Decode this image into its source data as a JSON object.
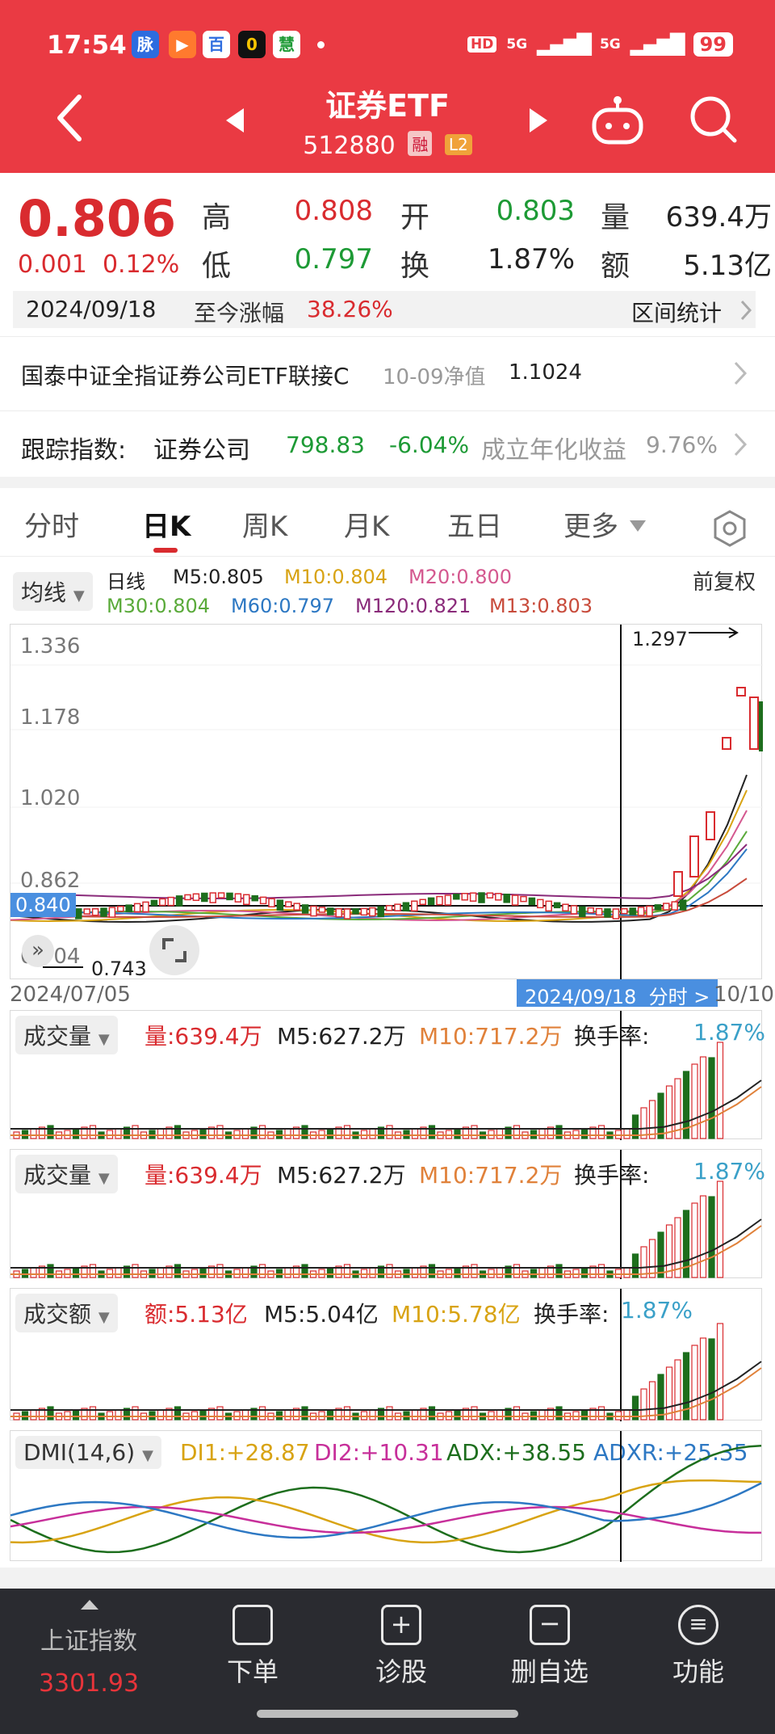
{
  "status": {
    "time": "17:54",
    "app_icons": [
      "脉",
      "▶",
      "百",
      "0",
      "慧"
    ],
    "battery": "99",
    "signal": "5G"
  },
  "header": {
    "title": "证券ETF",
    "code": "512880",
    "tag_margin": "融",
    "tag_level": "L2"
  },
  "quote": {
    "price": "0.806",
    "change": "0.001",
    "change_pct": "0.12%",
    "high_label": "高",
    "high": "0.808",
    "open_label": "开",
    "open": "0.803",
    "vol_label": "量",
    "vol": "639.4万",
    "low_label": "低",
    "low": "0.797",
    "turn_label": "换",
    "turn": "1.87%",
    "amt_label": "额",
    "amt": "5.13亿"
  },
  "range": {
    "date": "2024/09/18",
    "label": "至今涨幅",
    "value": "38.26%",
    "stat": "区间统计"
  },
  "fund": {
    "name": "国泰中证全指证券公司ETF联接C",
    "nav_label": "10-09净值",
    "nav": "1.1024"
  },
  "track": {
    "label": "跟踪指数:",
    "index": "证券公司",
    "value": "798.83",
    "pct": "-6.04%",
    "annual_label": "成立年化收益",
    "annual": "9.76%"
  },
  "tabs": [
    "分时",
    "日K",
    "周K",
    "月K",
    "五日",
    "更多"
  ],
  "ma": {
    "selector": "均线",
    "kind": "日线",
    "m5": "M5:0.805",
    "m10": "M10:0.804",
    "m20": "M20:0.800",
    "m30": "M30:0.804",
    "m60": "M60:0.797",
    "m120": "M120:0.821",
    "m13": "M13:0.803",
    "adjust": "前复权"
  },
  "kchart": {
    "y_ticks": [
      "1.336",
      "1.178",
      "1.020",
      "0.862",
      "0.704"
    ],
    "current_tag": "0.840",
    "high_mark": "1.297",
    "low_mark": "0.743",
    "date_start": "2024/07/05",
    "cursor_date": "2024/09/18",
    "cursor_btn": "分时",
    "date_end": "10/10"
  },
  "vol1": {
    "selector": "成交量",
    "v": "量:639.4万",
    "m5": "M5:627.2万",
    "m10": "M10:717.2万",
    "turn_label": "换手率:",
    "turn": "1.87%"
  },
  "vol2": {
    "selector": "成交量",
    "v": "量:639.4万",
    "m5": "M5:627.2万",
    "m10": "M10:717.2万",
    "turn_label": "换手率:",
    "turn": "1.87%"
  },
  "amt": {
    "selector": "成交额",
    "v": "额:5.13亿",
    "m5": "M5:5.04亿",
    "m10": "M10:5.78亿",
    "turn_label": "换手率:",
    "turn": "1.87%"
  },
  "dmi": {
    "selector": "DMI(14,6)",
    "di1": "DI1:+28.87",
    "di2": "DI2:+10.31",
    "adx": "ADX:+38.55",
    "adxr": "ADXR:+25.35"
  },
  "nav": {
    "index_name": "上证指数",
    "index_value": "3301.93",
    "items": [
      "下单",
      "诊股",
      "删自选",
      "功能"
    ]
  },
  "colors": {
    "up": "#d92b2f",
    "down": "#1d6e1d",
    "header": "#ea3a43"
  }
}
